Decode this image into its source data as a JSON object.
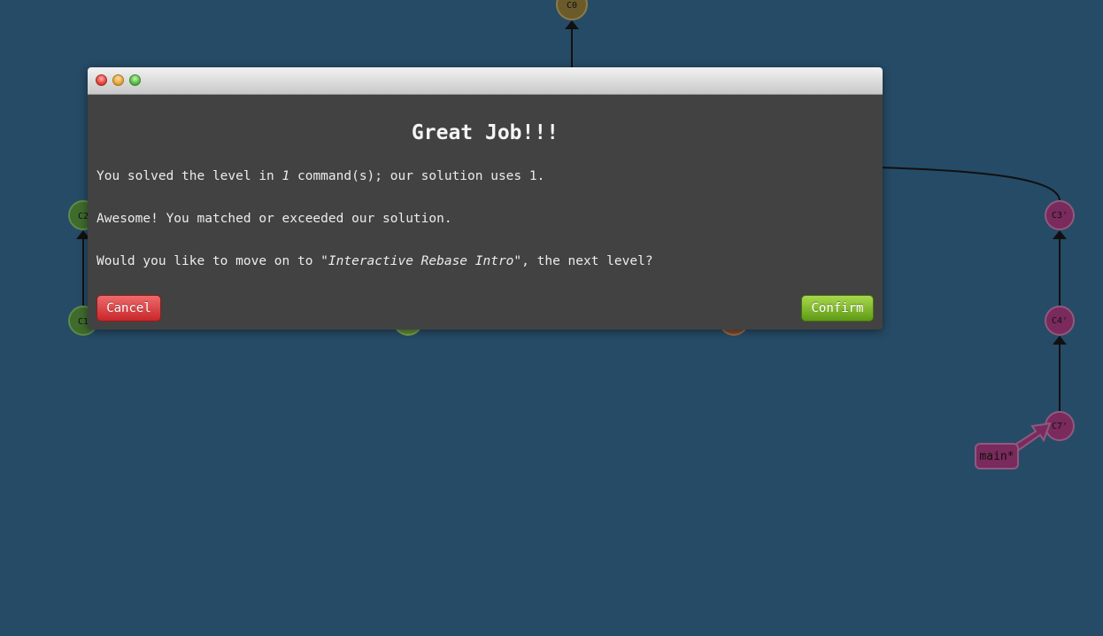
{
  "graph": {
    "commits": [
      {
        "id": "C0",
        "label": "C0",
        "color": "#6b5a2a"
      },
      {
        "id": "C2",
        "label": "C2",
        "color": "#3f6b2c"
      },
      {
        "id": "C1",
        "label": "C1",
        "color": "#3f6b2c"
      },
      {
        "id": "C3p",
        "label": "C3'",
        "color": "#7a2a5c"
      },
      {
        "id": "C4p",
        "label": "C4'",
        "color": "#7a2a5c"
      },
      {
        "id": "C7p",
        "label": "C7'",
        "color": "#7a2a5c"
      }
    ],
    "branch": {
      "label": "main*",
      "color": "#7a2a5c"
    }
  },
  "dialog": {
    "title": "Great Job!!!",
    "line1_prefix": "You solved the level in ",
    "line1_count": "1",
    "line1_suffix": " command(s); our solution uses 1.",
    "line2": "Awesome! You matched or exceeded our solution.",
    "line3_prefix": "Would you like to move on to ",
    "line3_level": "\"Interactive Rebase Intro\"",
    "line3_suffix": ", the next level?",
    "cancel_label": "Cancel",
    "confirm_label": "Confirm"
  }
}
